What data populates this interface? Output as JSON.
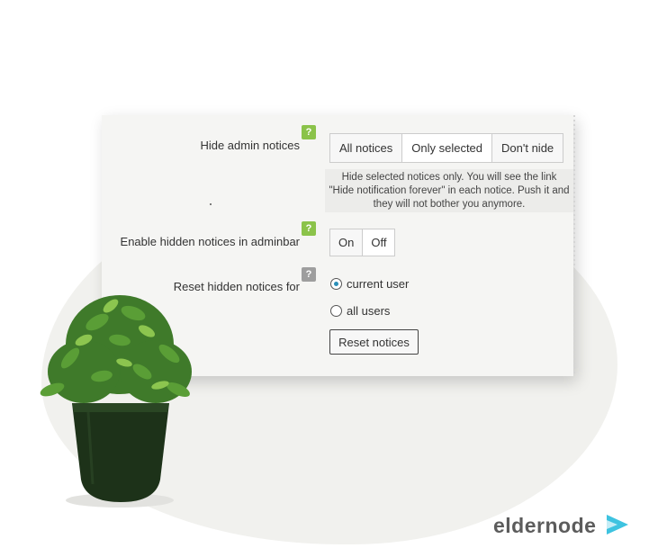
{
  "settings": {
    "hide_admin_notices": {
      "label": "Hide admin notices",
      "help": "?",
      "options": [
        "All notices",
        "Only selected",
        "Don't nide"
      ],
      "selected": "Only selected",
      "hint": "Hide selected notices only. You will see the link \"Hide notification forever\" in each notice. Push it and they will not bother you anymore."
    },
    "adminbar": {
      "label": "Enable hidden notices in adminbar",
      "help": "?",
      "on_label": "On",
      "off_label": "Off",
      "selected": "Off"
    },
    "reset": {
      "label": "Reset hidden notices for",
      "help": "?",
      "radio_current": "current user",
      "radio_all": "all users",
      "selected": "current user",
      "button_label": "Reset notices"
    }
  },
  "brand": {
    "logo_text": "eldernode",
    "accent_color": "#8bc34a",
    "logo_color": "#5c5c5c"
  }
}
